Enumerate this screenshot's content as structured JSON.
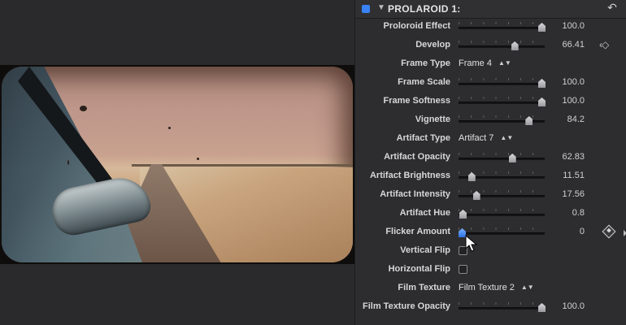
{
  "effect_panel": {
    "title": "PROLAROID 1:",
    "accent_color": "#3a82f6",
    "params": [
      {
        "label": "Proloroid Effect",
        "kind": "slider",
        "value": "100.0",
        "fraction": 1.0
      },
      {
        "label": "Develop",
        "kind": "slider",
        "value": "66.41",
        "fraction": 0.66,
        "keyframe_nav": true
      },
      {
        "label": "Frame Type",
        "kind": "popup",
        "selected": "Frame 4"
      },
      {
        "label": "Frame Scale",
        "kind": "slider",
        "value": "100.0",
        "fraction": 1.0
      },
      {
        "label": "Frame Softness",
        "kind": "slider",
        "value": "100.0",
        "fraction": 1.0
      },
      {
        "label": "Vignette",
        "kind": "slider",
        "value": "84.2",
        "fraction": 0.84
      },
      {
        "label": "Artifact Type",
        "kind": "popup",
        "selected": "Artifact 7"
      },
      {
        "label": "Artifact Opacity",
        "kind": "slider",
        "value": "62.83",
        "fraction": 0.63
      },
      {
        "label": "Artifact Brightness",
        "kind": "slider",
        "value": "11.51",
        "fraction": 0.12
      },
      {
        "label": "Artifact Intensity",
        "kind": "slider",
        "value": "17.56",
        "fraction": 0.18
      },
      {
        "label": "Artifact Hue",
        "kind": "slider",
        "value": "0.8",
        "fraction": 0.01
      },
      {
        "label": "Flicker Amount",
        "kind": "slider",
        "value": "0",
        "fraction": 0.0,
        "active": true,
        "keyframe_add": true
      },
      {
        "label": "Vertical Flip",
        "kind": "checkbox",
        "checked": false
      },
      {
        "label": "Horizontal Flip",
        "kind": "checkbox",
        "checked": false
      },
      {
        "label": "Film Texture",
        "kind": "popup",
        "selected": "Film Texture 2"
      },
      {
        "label": "Film Texture Opacity",
        "kind": "slider",
        "value": "100.0",
        "fraction": 1.0
      }
    ]
  },
  "icons": {
    "disclosure": "▼",
    "reset": "↶",
    "popup_arrows": "▲▼",
    "keyframe_nav": "‹◇"
  }
}
